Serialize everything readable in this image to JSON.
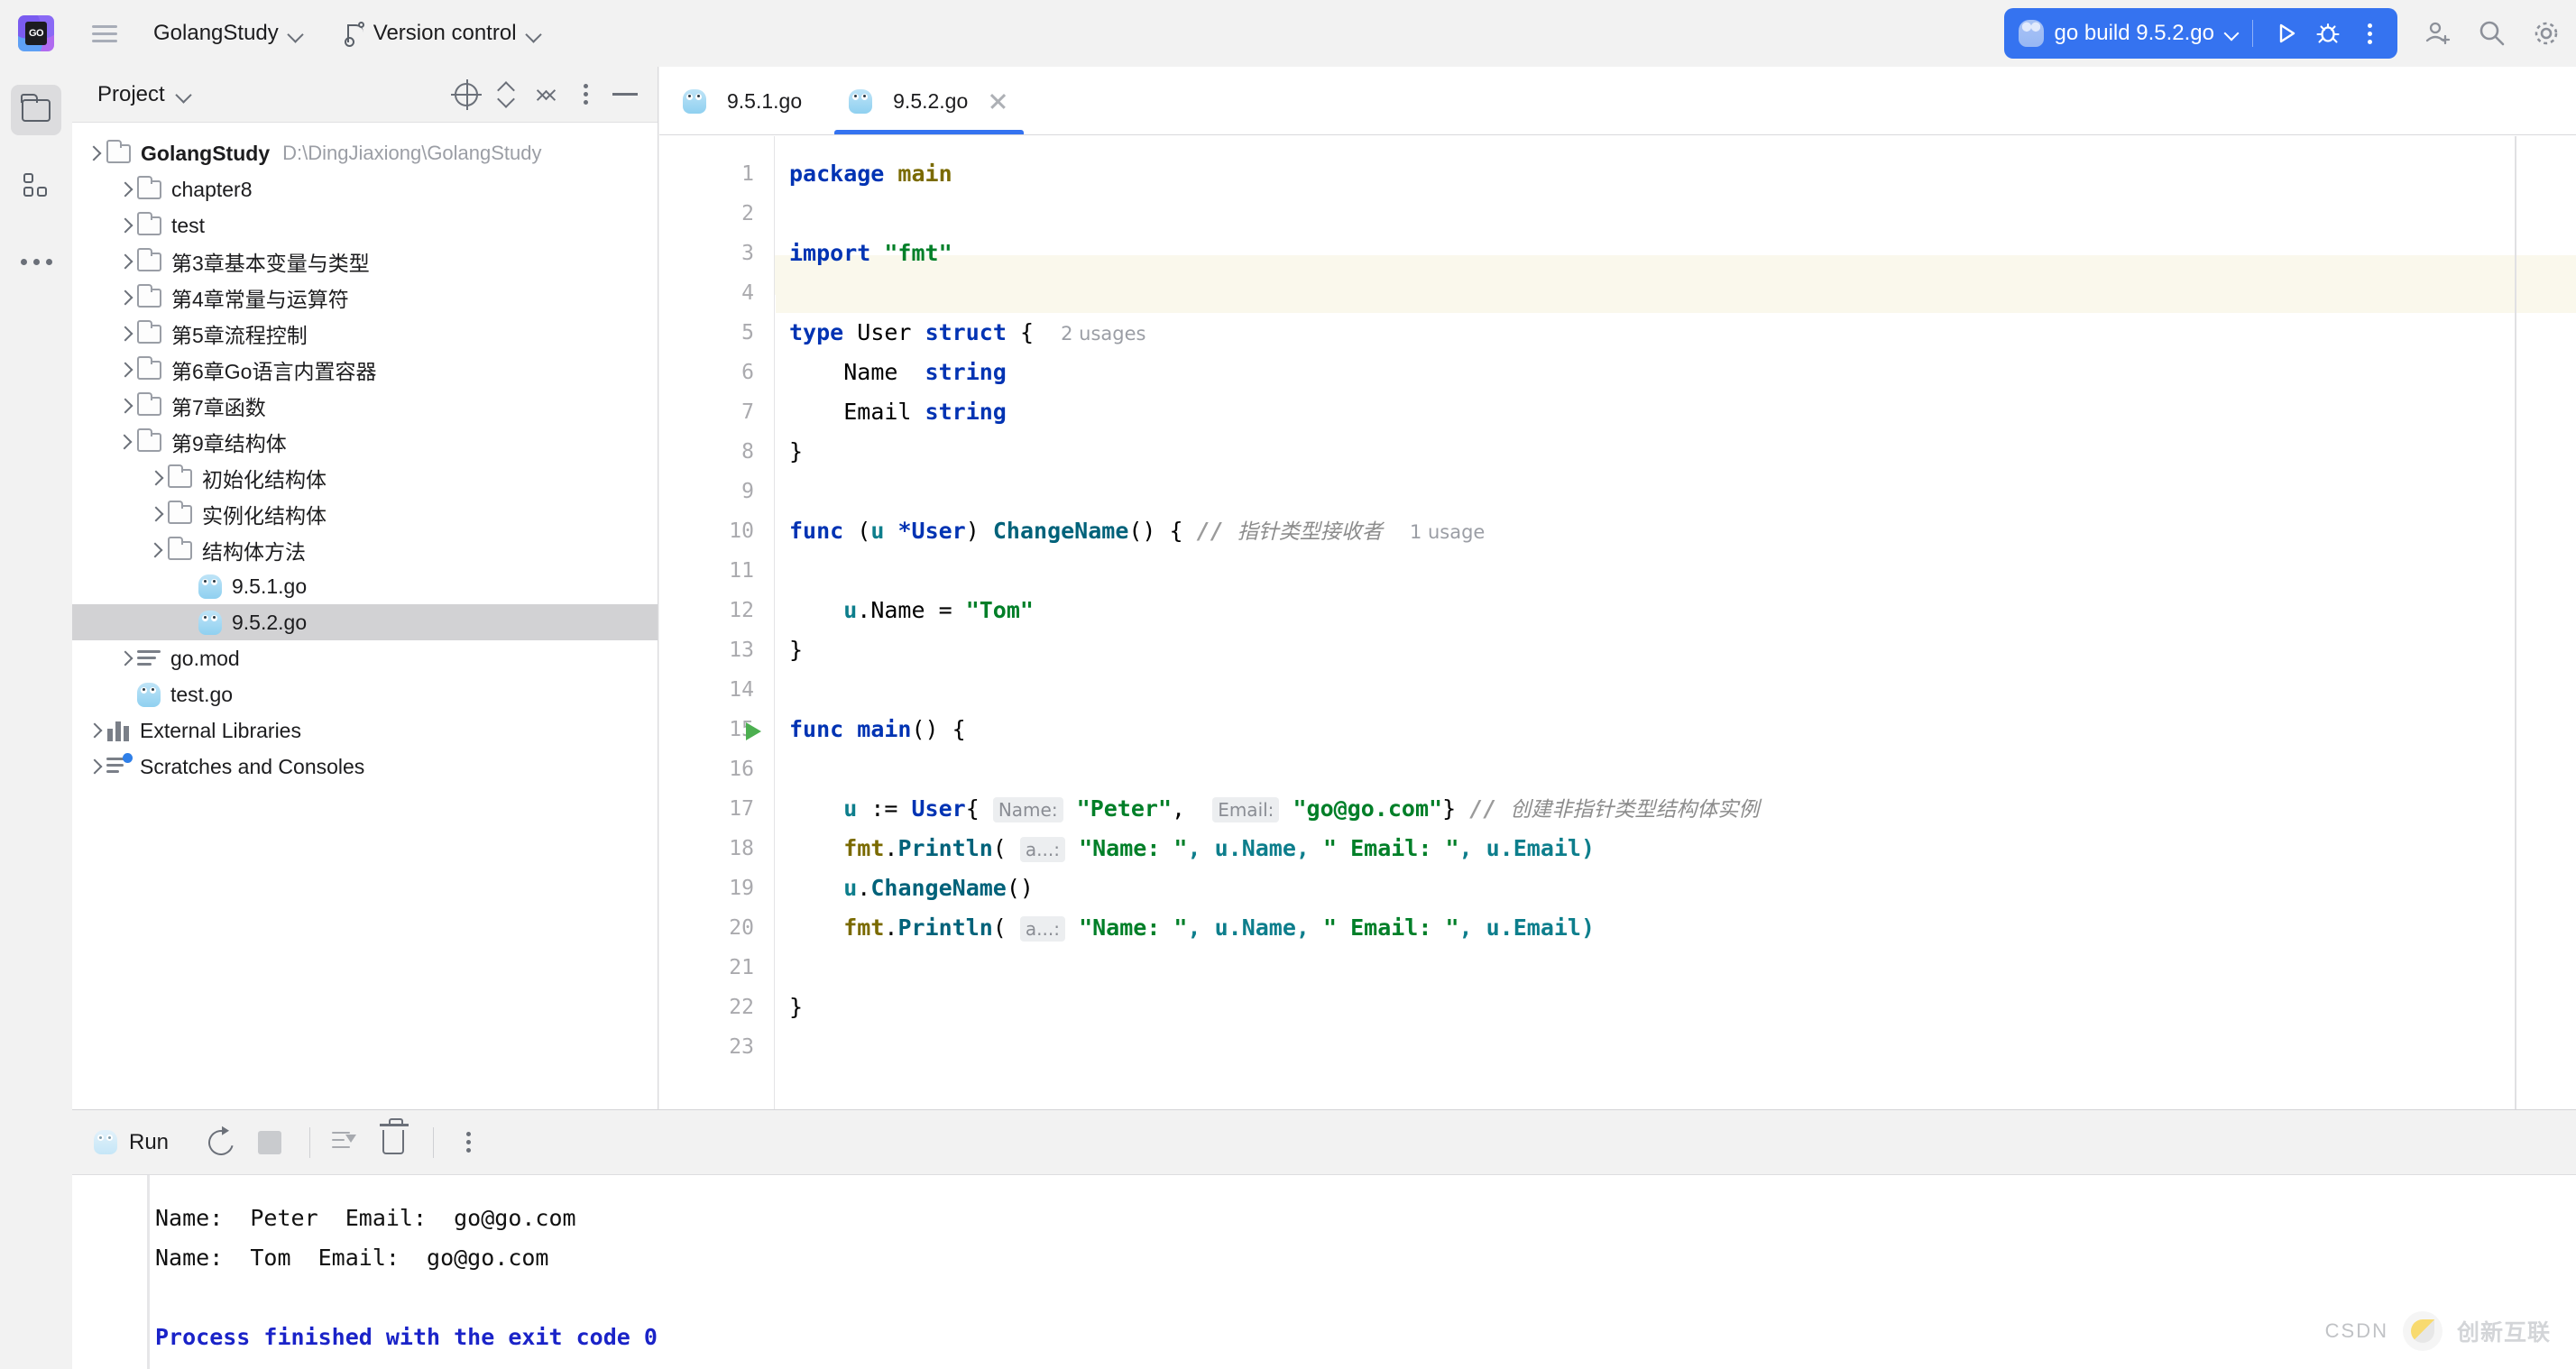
{
  "toolbar": {
    "logo_text": "GO",
    "project_name": "GolangStudy",
    "version_control": "Version control",
    "run_config": "go build 9.5.2.go",
    "icons": [
      "main-menu-icon",
      "branch-icon",
      "run-icon",
      "debug-icon",
      "more-icon",
      "add-user-icon",
      "search-icon",
      "settings-icon"
    ]
  },
  "activity_bar": {
    "items": [
      {
        "name": "project-icon",
        "label": "Project"
      },
      {
        "name": "structure-icon",
        "label": "Structure"
      },
      {
        "name": "more-tool-windows-icon",
        "label": "More"
      }
    ]
  },
  "project_panel": {
    "title": "Project",
    "header_icons": [
      "select-opened-file-icon",
      "expand-collapse-icon",
      "collapse-all-icon",
      "options-icon",
      "hide-icon"
    ],
    "tree": [
      {
        "label": "GolangStudy",
        "path": "D:\\DingJiaxiong\\GolangStudy",
        "indent": 0,
        "arrow": "open",
        "icon": "folder",
        "bold": true,
        "selected": false
      },
      {
        "label": "chapter8",
        "path": "",
        "indent": 1,
        "arrow": "closed",
        "icon": "folder",
        "bold": false,
        "selected": false
      },
      {
        "label": "test",
        "path": "",
        "indent": 1,
        "arrow": "closed",
        "icon": "folder",
        "bold": false,
        "selected": false
      },
      {
        "label": "第3章基本变量与类型",
        "path": "",
        "indent": 1,
        "arrow": "closed",
        "icon": "folder",
        "bold": false,
        "selected": false
      },
      {
        "label": "第4章常量与运算符",
        "path": "",
        "indent": 1,
        "arrow": "closed",
        "icon": "folder",
        "bold": false,
        "selected": false
      },
      {
        "label": "第5章流程控制",
        "path": "",
        "indent": 1,
        "arrow": "closed",
        "icon": "folder",
        "bold": false,
        "selected": false
      },
      {
        "label": "第6章Go语言内置容器",
        "path": "",
        "indent": 1,
        "arrow": "closed",
        "icon": "folder",
        "bold": false,
        "selected": false
      },
      {
        "label": "第7章函数",
        "path": "",
        "indent": 1,
        "arrow": "closed",
        "icon": "folder",
        "bold": false,
        "selected": false
      },
      {
        "label": "第9章结构体",
        "path": "",
        "indent": 1,
        "arrow": "open",
        "icon": "folder",
        "bold": false,
        "selected": false
      },
      {
        "label": "初始化结构体",
        "path": "",
        "indent": 2,
        "arrow": "closed",
        "icon": "folder",
        "bold": false,
        "selected": false
      },
      {
        "label": "实例化结构体",
        "path": "",
        "indent": 2,
        "arrow": "closed",
        "icon": "folder",
        "bold": false,
        "selected": false
      },
      {
        "label": "结构体方法",
        "path": "",
        "indent": 2,
        "arrow": "open",
        "icon": "folder",
        "bold": false,
        "selected": false
      },
      {
        "label": "9.5.1.go",
        "path": "",
        "indent": 3,
        "arrow": "none",
        "icon": "go",
        "bold": false,
        "selected": false
      },
      {
        "label": "9.5.2.go",
        "path": "",
        "indent": 3,
        "arrow": "none",
        "icon": "go",
        "bold": false,
        "selected": true
      },
      {
        "label": "go.mod",
        "path": "",
        "indent": 1,
        "arrow": "closed",
        "icon": "mod",
        "bold": false,
        "selected": false
      },
      {
        "label": "test.go",
        "path": "",
        "indent": 1,
        "arrow": "none",
        "icon": "go",
        "bold": false,
        "selected": false
      },
      {
        "label": "External Libraries",
        "path": "",
        "indent": 0,
        "arrow": "closed",
        "icon": "lib",
        "bold": false,
        "selected": false
      },
      {
        "label": "Scratches and Consoles",
        "path": "",
        "indent": 0,
        "arrow": "closed",
        "icon": "scratch",
        "bold": false,
        "selected": false
      }
    ]
  },
  "editor": {
    "tabs": [
      {
        "label": "9.5.1.go",
        "active": false,
        "closable": false
      },
      {
        "label": "9.5.2.go",
        "active": true,
        "closable": true
      }
    ],
    "highlighted_line": 4,
    "run_marker_line": 15,
    "total_lines": 23,
    "lines": [
      {
        "n": 1,
        "text": "package main"
      },
      {
        "n": 2,
        "text": ""
      },
      {
        "n": 3,
        "text": "import \"fmt\""
      },
      {
        "n": 4,
        "text": ""
      },
      {
        "n": 5,
        "text": "type User struct {",
        "inlay": "2 usages"
      },
      {
        "n": 6,
        "text": "    Name  string"
      },
      {
        "n": 7,
        "text": "    Email string"
      },
      {
        "n": 8,
        "text": "}"
      },
      {
        "n": 9,
        "text": ""
      },
      {
        "n": 10,
        "text": "func (u *User) ChangeName() { // 指针类型接收者",
        "inlay": "1 usage"
      },
      {
        "n": 11,
        "text": ""
      },
      {
        "n": 12,
        "text": "    u.Name = \"Tom\""
      },
      {
        "n": 13,
        "text": "}"
      },
      {
        "n": 14,
        "text": ""
      },
      {
        "n": 15,
        "text": "func main() {"
      },
      {
        "n": 16,
        "text": ""
      },
      {
        "n": 17,
        "text": "    u := User{ Name: \"Peter\",  Email: \"go@go.com\"} // 创建非指针类型结构体实例"
      },
      {
        "n": 18,
        "text": "    fmt.Println( a...: \"Name: \", u.Name, \" Email: \", u.Email)"
      },
      {
        "n": 19,
        "text": "    u.ChangeName()"
      },
      {
        "n": 20,
        "text": "    fmt.Println( a...: \"Name: \", u.Name, \" Email: \", u.Email)"
      },
      {
        "n": 21,
        "text": ""
      },
      {
        "n": 22,
        "text": "}"
      },
      {
        "n": 23,
        "text": ""
      }
    ],
    "tokens": {
      "l1_kw": "package",
      "l1_name": "main",
      "l3_kw": "import",
      "l3_str": "\"fmt\"",
      "l5_kw1": "type",
      "l5_name": "User",
      "l5_kw2": "struct",
      "l5_brace": "{",
      "l5_usages": "2 usages",
      "l6_field": "Name",
      "l6_type": "string",
      "l7_field": "Email",
      "l7_type": "string",
      "l8_brace": "}",
      "l10_kw": "func",
      "l10_recv_open": "(",
      "l10_recv_var": "u",
      "l10_star": "*",
      "l10_recv_type": "User",
      "l10_recv_close": ")",
      "l10_fn": "ChangeName",
      "l10_parens": "()",
      "l10_brace": "{",
      "l10_slashes": "//",
      "l10_comment": "指针类型接收者",
      "l10_usages": "1 usage",
      "l12_var": "u",
      "l12_field": ".Name",
      "l12_eq": "= ",
      "l12_str": "\"Tom\"",
      "l13_brace": "}",
      "l15_kw": "func",
      "l15_fn": "main",
      "l15_rest": "() {",
      "l17_var": "u",
      "l17_op": ":= ",
      "l17_type": "User",
      "l17_brace": "{",
      "l17_hint1": "Name:",
      "l17_str1": "\"Peter\"",
      "l17_comma": ",",
      "l17_hint2": "Email:",
      "l17_str2": "\"go@go.com\"",
      "l17_close": "}",
      "l17_slashes": "//",
      "l17_comment": "创建非指针类型结构体实例",
      "l18_pkg": "fmt",
      "l18_dot": ".",
      "l18_fn": "Println",
      "l18_open": "(",
      "l18_hint": "a...:",
      "l18_str1": "\"Name: \"",
      "l18_arg1": ", u.Name, ",
      "l18_str2": "\" Email: \"",
      "l18_arg2": ", u.Email)",
      "l19_var": "u",
      "l19_dot": ".",
      "l19_fn": "ChangeName",
      "l19_parens": "()",
      "l22_brace": "}"
    }
  },
  "run_panel": {
    "title": "Run",
    "icons": [
      "rerun-icon",
      "stop-icon",
      "soft-wrap-icon",
      "clear-all-icon",
      "more-icon"
    ],
    "console_lines": [
      {
        "text": "Name:  Peter  Email:  go@go.com",
        "style": "normal"
      },
      {
        "text": "Name:  Tom  Email:  go@go.com",
        "style": "normal"
      },
      {
        "text": "",
        "style": "normal"
      },
      {
        "text": "Process finished with the exit code 0",
        "style": "done"
      }
    ]
  },
  "watermark": {
    "text": "CSDN",
    "cn": "创新互联"
  },
  "colors": {
    "accent_blue": "#3573f0",
    "keyword": "#0033b3",
    "string": "#007f28",
    "function": "#00627a",
    "comment": "#9b9b9b",
    "toolbar_bg": "#f2f2f2",
    "selection": "#d2d2d4",
    "caret_line": "#faf8ec"
  }
}
